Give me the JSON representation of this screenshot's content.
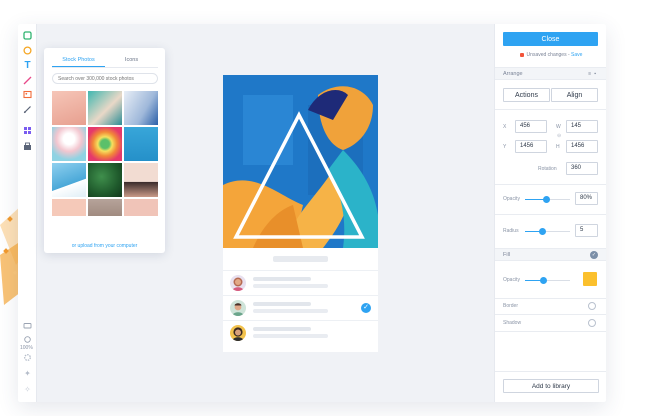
{
  "colors": {
    "accent": "#2ea3f2",
    "unsaved_dot": "#f2543a",
    "fill_swatch": "#fbc02d"
  },
  "toolbar": {
    "tools": [
      "shape-tool-icon",
      "circle-tool-icon",
      "text-tool-icon",
      "line-tool-icon",
      "image-tool-icon",
      "pen-tool-icon",
      "components-icon",
      "library-icon"
    ],
    "zoom": "100%"
  },
  "image_panel": {
    "tabs": [
      "Stock Photos",
      "Icons"
    ],
    "active_tab": "Stock Photos",
    "search_placeholder": "Search over 300,000 stock photos",
    "upload_link": "or upload from your computer"
  },
  "inspector": {
    "close_label": "Close",
    "unsaved_text": "Unsaved changes - ",
    "save_link": "Save",
    "arrange_label": "Arrange",
    "actions_label": "Actions",
    "align_label": "Align",
    "x_label": "X",
    "x_value": "456",
    "y_label": "Y",
    "y_value": "1456",
    "w_label": "W",
    "w_value": "145",
    "h_label": "H",
    "h_value": "1456",
    "rotation_label": "Rotation",
    "rotation_value": "360",
    "opacity_label": "Opacity",
    "opacity_value": "80%",
    "opacity_level": 0.8,
    "radius_label": "Radius",
    "radius_value": "5",
    "fill_label": "Fill",
    "fill_opacity_label": "Opacity",
    "border_label": "Border",
    "shadow_label": "Shadow",
    "add_library_label": "Add to library"
  }
}
